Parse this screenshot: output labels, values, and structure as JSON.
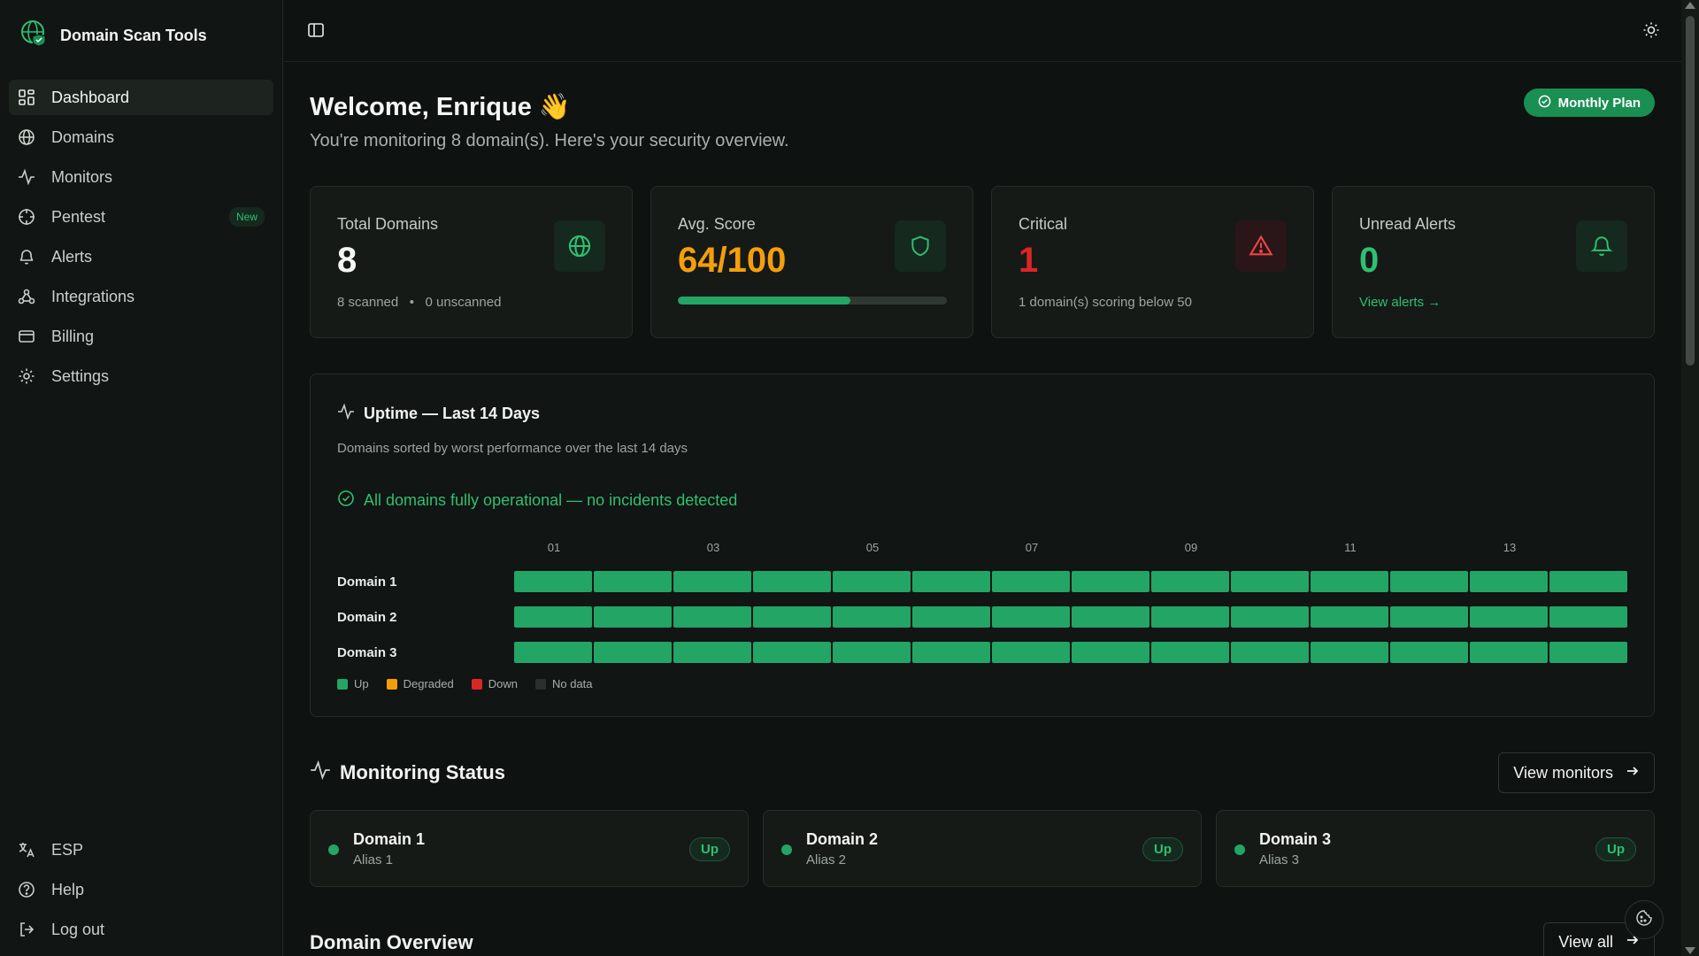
{
  "app": {
    "name": "Domain Scan Tools"
  },
  "sidebar": {
    "items": [
      {
        "label": "Dashboard",
        "icon": "dashboard-icon",
        "active": true
      },
      {
        "label": "Domains",
        "icon": "globe-icon"
      },
      {
        "label": "Monitors",
        "icon": "activity-icon"
      },
      {
        "label": "Pentest",
        "icon": "target-icon",
        "badge": "New"
      },
      {
        "label": "Alerts",
        "icon": "bell-icon"
      },
      {
        "label": "Integrations",
        "icon": "webhook-icon"
      },
      {
        "label": "Billing",
        "icon": "credit-card-icon"
      },
      {
        "label": "Settings",
        "icon": "gear-icon"
      }
    ],
    "bottom": [
      {
        "label": "ESP",
        "icon": "language-icon"
      },
      {
        "label": "Help",
        "icon": "help-icon"
      },
      {
        "label": "Log out",
        "icon": "logout-icon"
      }
    ]
  },
  "header": {
    "title": "Welcome, Enrique",
    "emoji": "👋",
    "subtitle": "You're monitoring 8 domain(s). Here's your security overview.",
    "plan_badge": "Monthly Plan"
  },
  "stats": {
    "total": {
      "title": "Total Domains",
      "value": "8",
      "scanned": "8 scanned",
      "unscanned": "0 unscanned",
      "color": "#f4f7f5"
    },
    "score": {
      "title": "Avg. Score",
      "value": "64/100",
      "progress": 0.64,
      "color": "#f59e0b"
    },
    "critical": {
      "title": "Critical",
      "value": "1",
      "sub": "1 domain(s) scoring below 50",
      "color": "#dc2626"
    },
    "alerts": {
      "title": "Unread Alerts",
      "value": "0",
      "link": "View alerts →",
      "color": "#2fbf71"
    }
  },
  "uptime": {
    "title": "Uptime — Last 14 Days",
    "description": "Domains sorted by worst performance over the last 14 days",
    "status": "All domains fully operational — no incidents detected",
    "legend": [
      {
        "label": "Up",
        "color": "#22a565"
      },
      {
        "label": "Degraded",
        "color": "#f59e0b"
      },
      {
        "label": "Down",
        "color": "#dc2626"
      },
      {
        "label": "No data",
        "color": "#2a302c"
      }
    ]
  },
  "chart_data": {
    "type": "heatmap",
    "x": [
      "01",
      "02",
      "03",
      "04",
      "05",
      "06",
      "07",
      "08",
      "09",
      "10",
      "11",
      "12",
      "13",
      "14"
    ],
    "x_tick_labels": [
      "01",
      "",
      "03",
      "",
      "05",
      "",
      "07",
      "",
      "09",
      "",
      "11",
      "",
      "13",
      ""
    ],
    "rows": [
      {
        "name": "Domain 1",
        "values": [
          "up",
          "up",
          "up",
          "up",
          "up",
          "up",
          "up",
          "up",
          "up",
          "up",
          "up",
          "up",
          "up",
          "up"
        ]
      },
      {
        "name": "Domain 2",
        "values": [
          "up",
          "up",
          "up",
          "up",
          "up",
          "up",
          "up",
          "up",
          "up",
          "up",
          "up",
          "up",
          "up",
          "up"
        ]
      },
      {
        "name": "Domain 3",
        "values": [
          "up",
          "up",
          "up",
          "up",
          "up",
          "up",
          "up",
          "up",
          "up",
          "up",
          "up",
          "up",
          "up",
          "up"
        ]
      }
    ],
    "status_colors": {
      "up": "#22a565",
      "degraded": "#f59e0b",
      "down": "#dc2626",
      "none": "#2a302c"
    }
  },
  "monitoring": {
    "title": "Monitoring Status",
    "view_button": "View monitors",
    "items": [
      {
        "name": "Domain 1",
        "alias": "Alias 1",
        "status": "Up"
      },
      {
        "name": "Domain 2",
        "alias": "Alias 2",
        "status": "Up"
      },
      {
        "name": "Domain 3",
        "alias": "Alias 3",
        "status": "Up"
      }
    ]
  },
  "overview": {
    "title": "Domain Overview",
    "view_button": "View all"
  }
}
